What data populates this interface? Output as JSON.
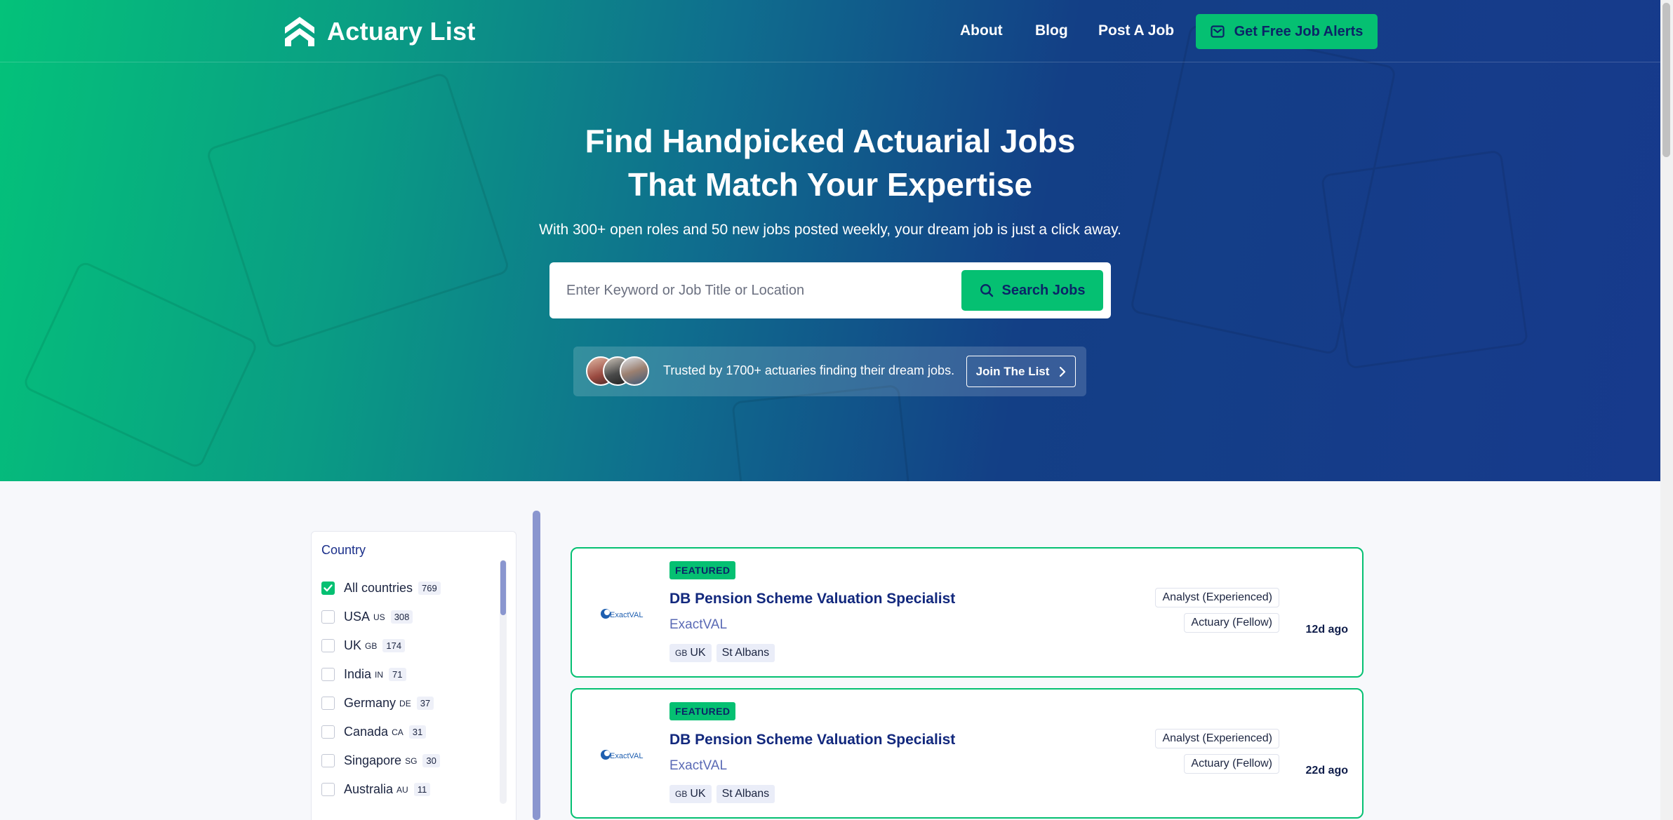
{
  "brand": {
    "name": "Actuary List"
  },
  "nav": {
    "about": "About",
    "blog": "Blog",
    "post_job": "Post A Job",
    "alerts_button": "Get Free Job Alerts"
  },
  "hero": {
    "title_line1": "Find Handpicked Actuarial Jobs",
    "title_line2": "That Match Your Expertise",
    "subtitle": "With 300+ open roles and 50 new jobs posted weekly, your dream job is just a click away.",
    "search_placeholder": "Enter Keyword or Job Title or Location",
    "search_value": "",
    "search_button": "Search Jobs",
    "trust_text": "Trusted by 1700+ actuaries finding their dream jobs.",
    "join_button": "Join The List"
  },
  "filters": {
    "country_title": "Country",
    "countries": [
      {
        "name": "All countries",
        "code": "",
        "count": "769",
        "checked": true
      },
      {
        "name": "USA",
        "code": "US",
        "count": "308",
        "checked": false
      },
      {
        "name": "UK",
        "code": "GB",
        "count": "174",
        "checked": false
      },
      {
        "name": "India",
        "code": "IN",
        "count": "71",
        "checked": false
      },
      {
        "name": "Germany",
        "code": "DE",
        "count": "37",
        "checked": false
      },
      {
        "name": "Canada",
        "code": "CA",
        "count": "31",
        "checked": false
      },
      {
        "name": "Singapore",
        "code": "SG",
        "count": "30",
        "checked": false
      },
      {
        "name": "Australia",
        "code": "AU",
        "count": "11",
        "checked": false
      }
    ]
  },
  "jobs": [
    {
      "badge": "FEATURED",
      "title": "DB Pension Scheme Valuation Specialist",
      "company": "ExactVAL",
      "logo_text": "ExactVAL",
      "country_code": "GB",
      "country": "UK",
      "city": "St Albans",
      "category1": "Analyst (Experienced)",
      "category2": "Actuary (Fellow)",
      "posted": "12d ago"
    },
    {
      "badge": "FEATURED",
      "title": "DB Pension Scheme Valuation Specialist",
      "company": "ExactVAL",
      "logo_text": "ExactVAL",
      "country_code": "GB",
      "country": "UK",
      "city": "St Albans",
      "category1": "Analyst (Experienced)",
      "category2": "Actuary (Fellow)",
      "posted": "22d ago"
    }
  ],
  "colors": {
    "accent_green": "#05c072",
    "navy": "#0b2467",
    "hero_start": "#04c27a",
    "hero_end": "#173a8c"
  },
  "icons": {
    "logo": "actuary-list-logo-icon",
    "alerts": "envelope-icon",
    "search": "search-icon",
    "join": "chevron-right-icon",
    "checkbox": "checkmark-icon"
  }
}
